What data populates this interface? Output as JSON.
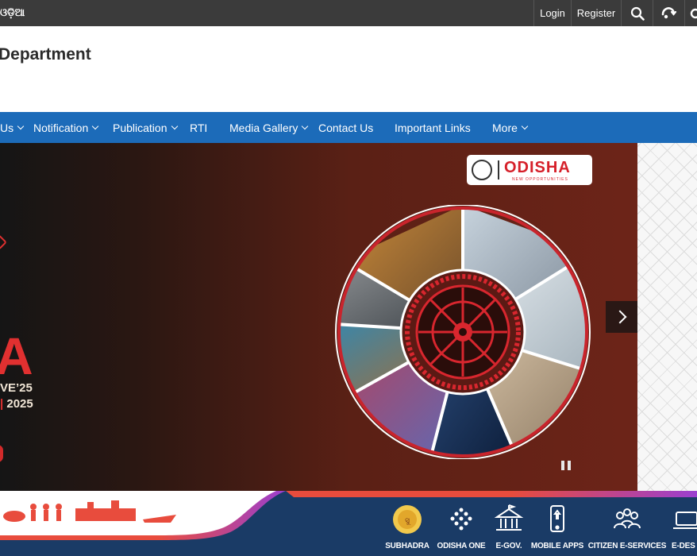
{
  "topbar": {
    "language": "ଓଡ଼ିଆ",
    "login": "Login",
    "register": "Register"
  },
  "header": {
    "title": "Department"
  },
  "nav": {
    "items": [
      {
        "label": "Us",
        "dropdown": true
      },
      {
        "label": "Notification",
        "dropdown": true
      },
      {
        "label": "Publication",
        "dropdown": true
      },
      {
        "label": "RTI",
        "dropdown": false
      },
      {
        "label": "Media Gallery",
        "dropdown": true
      },
      {
        "label": "Contact Us",
        "dropdown": false
      },
      {
        "label": "Important Links",
        "dropdown": false
      },
      {
        "label": "More",
        "dropdown": true
      }
    ]
  },
  "hero": {
    "big_letter": "A",
    "tagline_1": "VE’25",
    "tagline_2_sep": "|",
    "tagline_2_year": "2025",
    "logo_word": "ODISHA",
    "logo_sub": "NEW OPPORTUNITIES"
  },
  "quick_links": [
    {
      "label": "SUBHADRA",
      "icon": "subhadra-icon"
    },
    {
      "label": "ODISHA ONE",
      "icon": "odisha-one-icon"
    },
    {
      "label": "E-GOV.",
      "icon": "egov-icon"
    },
    {
      "label": "MOBILE APPS",
      "icon": "mobile-apps-icon"
    },
    {
      "label": "CITIZEN E-SERVICES",
      "icon": "citizen-eservices-icon"
    },
    {
      "label": "E-DES",
      "icon": "e-desk-icon"
    }
  ],
  "colors": {
    "topbar": "#3b3b3b",
    "nav": "#1c6bb9",
    "hero_bg": "#6d2418",
    "accent_red": "#e03030",
    "bottom_strip": "#1a3b66"
  }
}
